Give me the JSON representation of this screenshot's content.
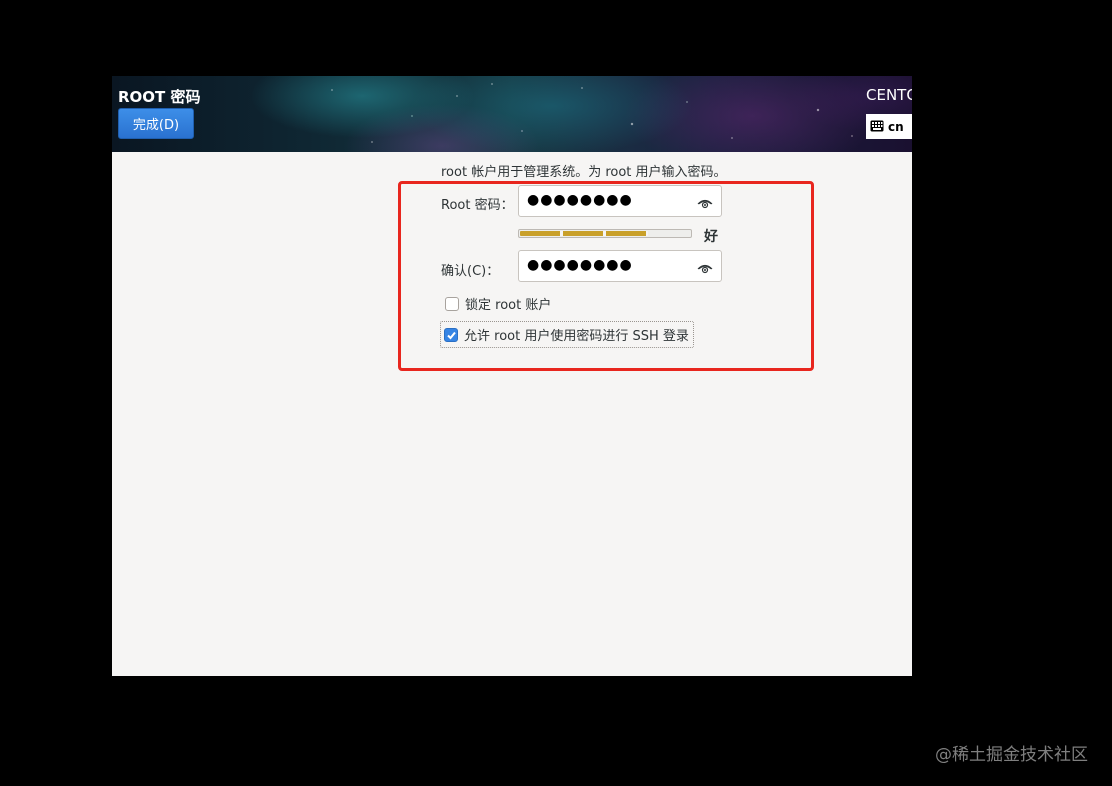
{
  "header": {
    "title": "ROOT 密码",
    "done_button": "完成(D)",
    "distro": "CENTOS",
    "keyboard_layout": "cn"
  },
  "form": {
    "description": "root 帐户用于管理系统。为 root 用户输入密码。",
    "password_label": "Root 密码：",
    "password_value": "●●●●●●●●",
    "strength": {
      "level": 0.75,
      "label": "好"
    },
    "confirm_label": "确认(C)：",
    "confirm_value": "●●●●●●●●",
    "lock_root_label": "锁定 root 账户",
    "lock_root_checked": false,
    "allow_ssh_label": "允许 root 用户使用密码进行 SSH 登录",
    "allow_ssh_checked": true
  },
  "annotation": {
    "highlight_color": "#e8261e"
  },
  "watermark": "@稀土掘金技术社区",
  "icons": {
    "done": "none",
    "keyboard": "keyboard-icon",
    "reveal": "eye-icon"
  }
}
